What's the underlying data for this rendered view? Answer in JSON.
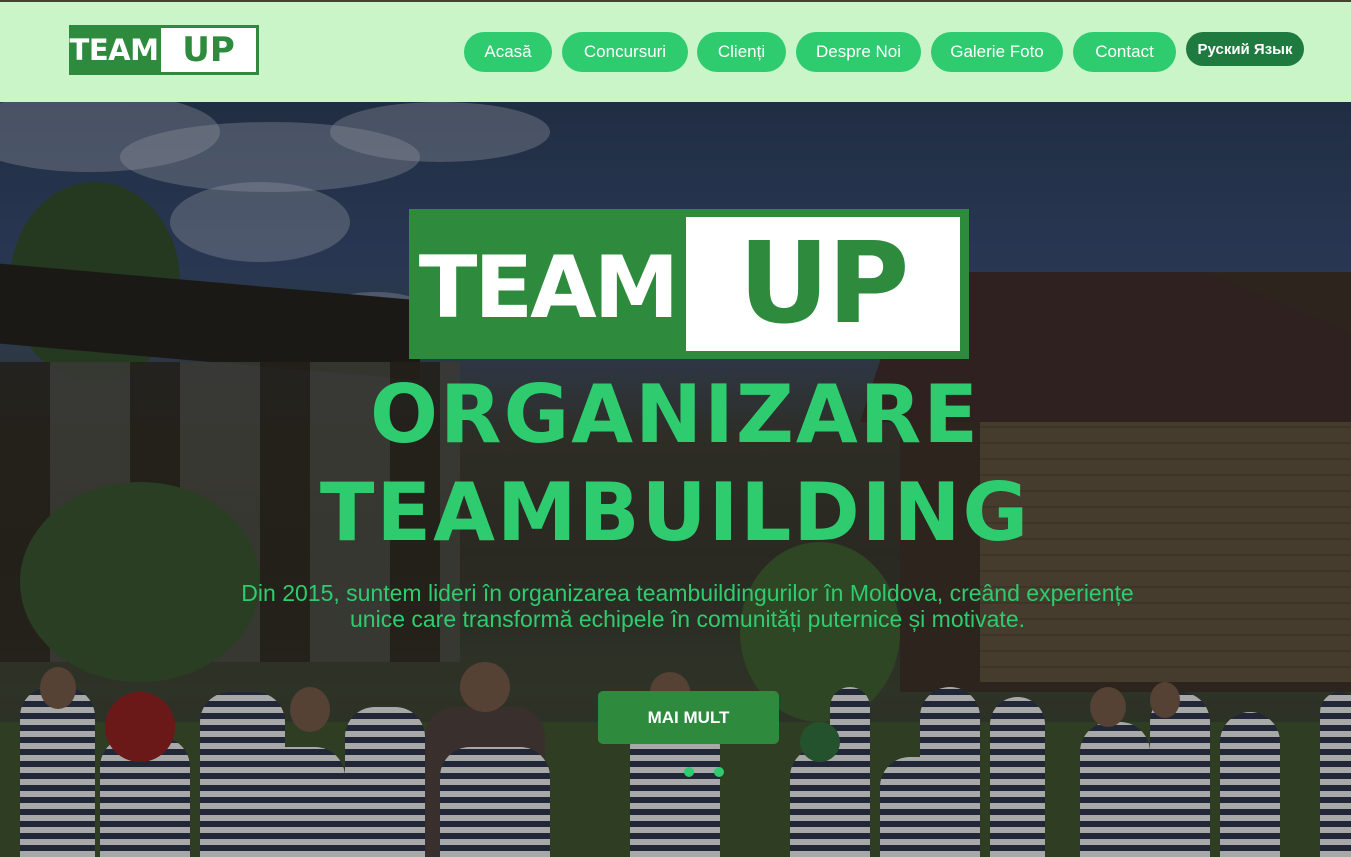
{
  "header": {
    "logo": {
      "team": "TEAM",
      "up": "UP"
    },
    "nav": [
      {
        "label": "Acasă"
      },
      {
        "label": "Concursuri"
      },
      {
        "label": "Clienți"
      },
      {
        "label": "Despre Noi"
      },
      {
        "label": "Galerie Foto"
      },
      {
        "label": "Contact"
      }
    ],
    "language_button": "Руский Язык"
  },
  "hero": {
    "logo": {
      "team": "TEAM",
      "up": "UP"
    },
    "title_line1": "ORGANIZARE",
    "title_line2": "TEAMBUILDING",
    "description": "Din 2015, suntem lideri în organizarea teambuildingurilor în Moldova, creând experiențe unice care transformă echipele în comunități puternice și motivate.",
    "cta": "MAI MULT",
    "slides": 2
  },
  "colors": {
    "accent_green": "#2ecc6e",
    "dark_green": "#2e8b3d",
    "nav_background": "#c9f5c9",
    "language_button": "#1e7a3f"
  }
}
